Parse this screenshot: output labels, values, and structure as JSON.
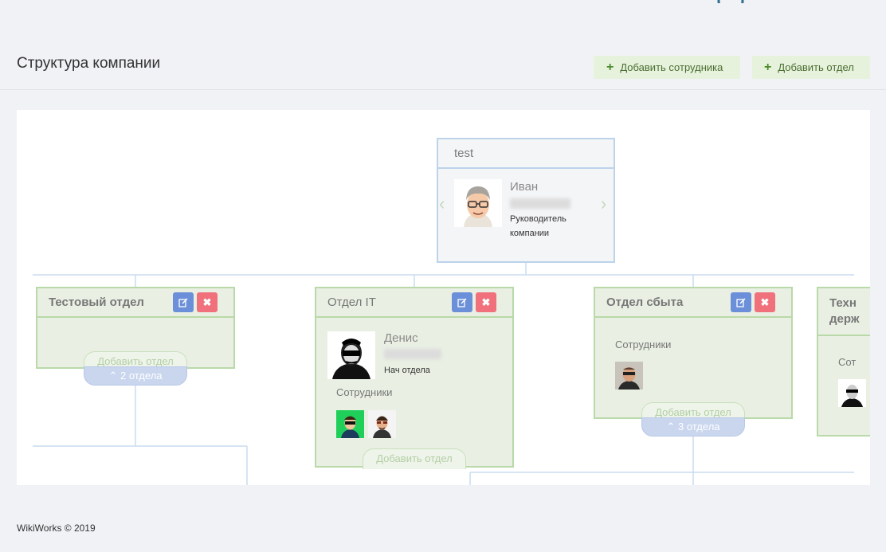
{
  "header": {
    "title": "Структура компании",
    "add_employee_label": "Добавить сотрудника",
    "add_department_label": "Добавить отдел",
    "plus_icon": "plus-icon"
  },
  "root": {
    "title": "test",
    "person_name": "Иван",
    "person_role": "Руководитель компании"
  },
  "departments": [
    {
      "title": "Тестовый отдел",
      "add_label": "Добавить отдел",
      "count_label": "2 отдела"
    },
    {
      "title": "Отдел IT",
      "person_name": "Денис",
      "person_role": "Нач отдела",
      "employees_label": "Сотрудники",
      "add_label": "Добавить отдел"
    },
    {
      "title": "Отдел сбыта",
      "employees_label": "Сотрудники",
      "add_label": "Добавить отдел",
      "count_label": "3 отдела"
    },
    {
      "title": "Техн держ",
      "employees_label": "Сот"
    }
  ],
  "footer": {
    "text": "WikiWorks © 2019"
  },
  "colors": {
    "card_green_bg": "#e9f0e3",
    "card_green_border": "#b9d9a8",
    "root_border": "#bcd3ea",
    "edit_button": "#6b8fd8",
    "delete_button": "#f0717b",
    "add_button_bg": "#e6f2dc"
  }
}
